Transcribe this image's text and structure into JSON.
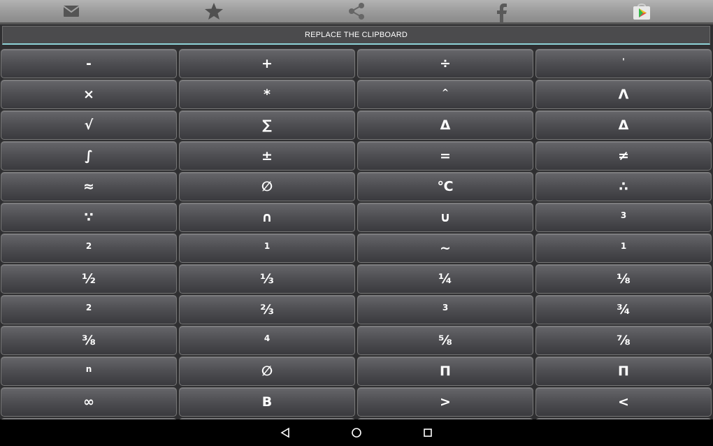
{
  "toolbar": {
    "icons": [
      "mail-icon",
      "star-icon",
      "share-icon",
      "facebook-icon",
      "play-store-icon"
    ]
  },
  "clipboard": {
    "label": "REPLACE THE CLIPBOARD"
  },
  "keys": [
    {
      "label": "-",
      "size": "normal"
    },
    {
      "label": "+",
      "size": "normal"
    },
    {
      "label": "÷",
      "size": "normal"
    },
    {
      "label": "'",
      "size": "small"
    },
    {
      "label": "×",
      "size": "normal"
    },
    {
      "label": "*",
      "size": "normal"
    },
    {
      "label": "^",
      "size": "small"
    },
    {
      "label": "Λ",
      "size": "normal"
    },
    {
      "label": "√",
      "size": "normal"
    },
    {
      "label": "∑",
      "size": "normal"
    },
    {
      "label": "Δ",
      "size": "normal"
    },
    {
      "label": "Δ",
      "size": "normal"
    },
    {
      "label": "∫",
      "size": "normal"
    },
    {
      "label": "±",
      "size": "normal"
    },
    {
      "label": "=",
      "size": "normal"
    },
    {
      "label": "≠",
      "size": "normal"
    },
    {
      "label": "≈",
      "size": "normal"
    },
    {
      "label": "∅",
      "size": "normal"
    },
    {
      "label": "℃",
      "size": "normal"
    },
    {
      "label": "∴",
      "size": "normal"
    },
    {
      "label": "∵",
      "size": "normal"
    },
    {
      "label": "∩",
      "size": "normal"
    },
    {
      "label": "∪",
      "size": "normal"
    },
    {
      "label": "3",
      "size": "small"
    },
    {
      "label": "2",
      "size": "small"
    },
    {
      "label": "1",
      "size": "small"
    },
    {
      "label": "~",
      "size": "normal"
    },
    {
      "label": "1",
      "size": "small"
    },
    {
      "label": "½",
      "size": "normal"
    },
    {
      "label": "⅓",
      "size": "normal"
    },
    {
      "label": "¼",
      "size": "normal"
    },
    {
      "label": "⅛",
      "size": "normal"
    },
    {
      "label": "2",
      "size": "small"
    },
    {
      "label": "⅔",
      "size": "normal"
    },
    {
      "label": "3",
      "size": "small"
    },
    {
      "label": "¾",
      "size": "normal"
    },
    {
      "label": "⅜",
      "size": "normal"
    },
    {
      "label": "4",
      "size": "small"
    },
    {
      "label": "⅝",
      "size": "normal"
    },
    {
      "label": "⅞",
      "size": "normal"
    },
    {
      "label": "n",
      "size": "small"
    },
    {
      "label": "∅",
      "size": "normal"
    },
    {
      "label": "Π",
      "size": "normal"
    },
    {
      "label": "Π",
      "size": "normal"
    },
    {
      "label": "∞",
      "size": "normal"
    },
    {
      "label": "B",
      "size": "normal"
    },
    {
      "label": ">",
      "size": "normal"
    },
    {
      "label": "<",
      "size": "normal"
    },
    {
      "label": "",
      "size": "normal"
    },
    {
      "label": "",
      "size": "normal"
    },
    {
      "label": "",
      "size": "normal"
    },
    {
      "label": "",
      "size": "normal"
    }
  ],
  "navbar": {
    "icons": [
      "back-icon",
      "home-icon",
      "recents-icon"
    ]
  },
  "colors": {
    "accent": "#8fd3d8",
    "key_text": "#ffffff",
    "toolbar_icon": "#5a5a5a"
  }
}
